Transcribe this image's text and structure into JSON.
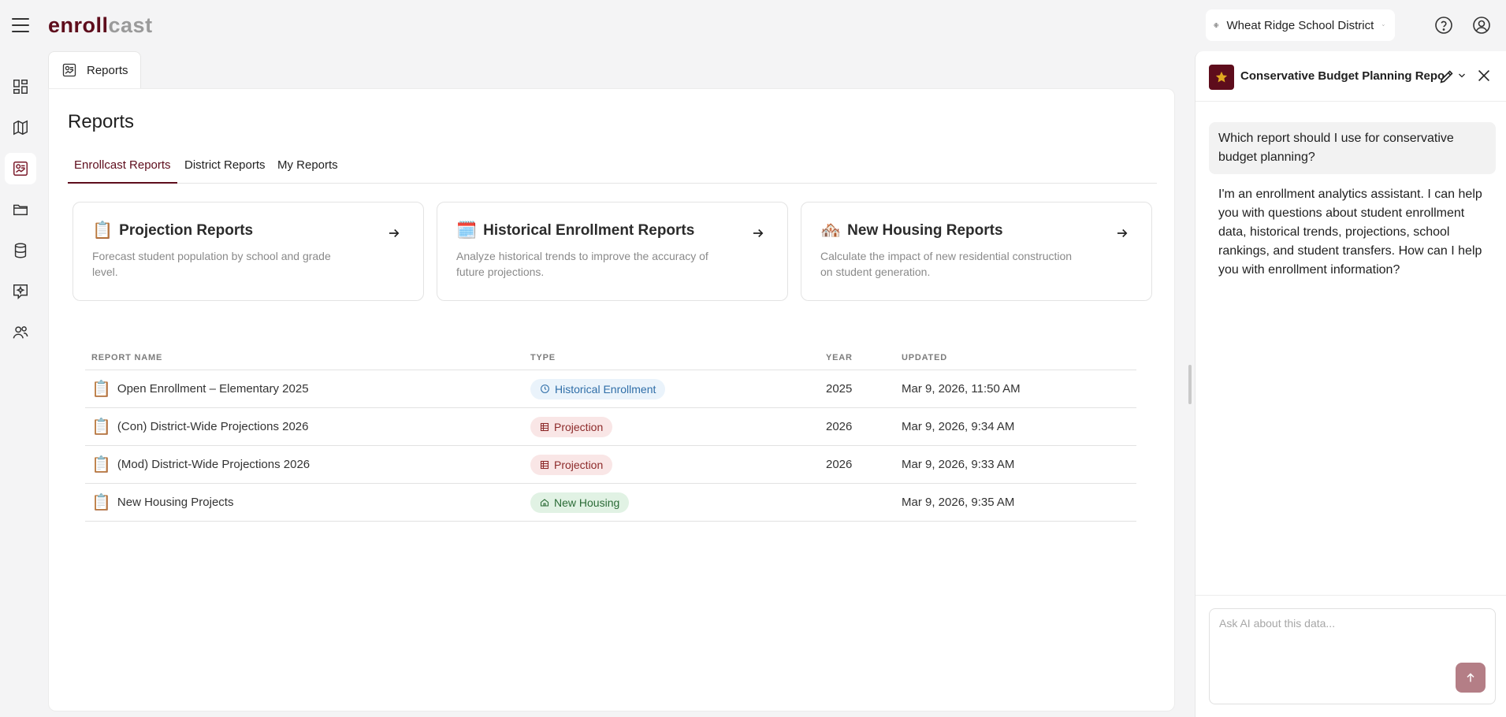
{
  "app": {
    "logo_part1": "enroll",
    "logo_part2": "cast"
  },
  "header": {
    "district_name": "Wheat Ridge School District"
  },
  "page_tab": {
    "label": "Reports"
  },
  "main": {
    "title": "Reports",
    "tabs": [
      {
        "label": "Enrollcast Reports",
        "active": true
      },
      {
        "label": "District Reports",
        "active": false
      },
      {
        "label": "My Reports",
        "active": false
      }
    ],
    "cards": [
      {
        "emoji": "📋",
        "title": "Projection Reports",
        "desc": "Forecast student population by school and grade level."
      },
      {
        "emoji": "🗓️",
        "title": "Historical Enrollment Reports",
        "desc": "Analyze historical trends to improve the accuracy of future projections."
      },
      {
        "emoji": "🏘️",
        "title": "New Housing Reports",
        "desc": "Calculate the impact of new residential construction on student generation."
      }
    ],
    "table": {
      "headers": [
        "REPORT NAME",
        "TYPE",
        "YEAR",
        "UPDATED"
      ],
      "rows": [
        {
          "name": "Open Enrollment – Elementary 2025",
          "type": "Historical Enrollment",
          "year": "2025",
          "updated": "Mar 9, 2026, 11:50 AM"
        },
        {
          "name": "(Con) District-Wide Projections 2026",
          "type": "Projection",
          "year": "2026",
          "updated": "Mar 9, 2026, 9:34 AM"
        },
        {
          "name": "(Mod) District-Wide Projections 2026",
          "type": "Projection",
          "year": "2026",
          "updated": "Mar 9, 2026, 9:33 AM"
        },
        {
          "name": "New Housing Projects",
          "type": "New Housing",
          "year": "",
          "updated": "Mar 9, 2026, 9:35 AM"
        }
      ]
    }
  },
  "ai_panel": {
    "title": "Conservative Budget Planning Report",
    "user_message": "Which report should I use for conservative budget planning?",
    "bot_message": "I'm an enrollment analytics assistant. I can help you with questions about student enrollment data, historical trends, projections, school rankings, and student transfers. How can I help you with enrollment information?",
    "input_placeholder": "Ask AI about this data..."
  },
  "colors": {
    "brand": "#5e0d1c",
    "send_button": "#b47e86",
    "badge_historical": "#2f6ea8",
    "badge_projection": "#8d2a2a",
    "badge_housing": "#2a6b36"
  }
}
